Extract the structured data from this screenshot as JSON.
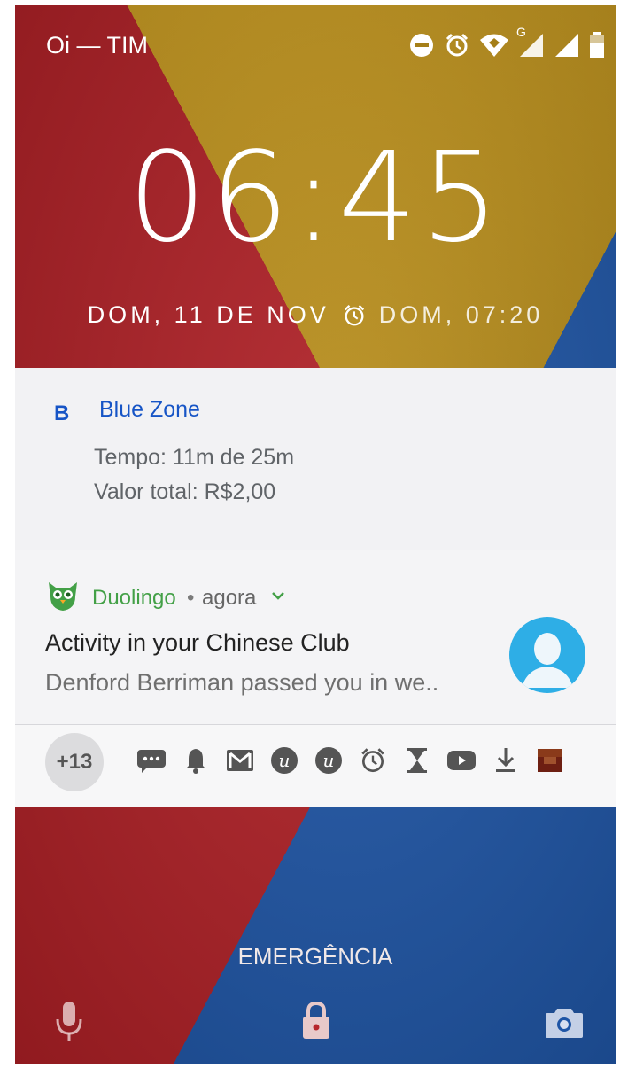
{
  "status_bar": {
    "carrier": "Oi — TIM",
    "icons": [
      "do-not-disturb-icon",
      "alarm-icon",
      "wifi-icon",
      "signal-g-icon",
      "signal-icon",
      "signal-icon",
      "battery-icon"
    ],
    "network_type": "G"
  },
  "lockscreen": {
    "time": "06:45",
    "date": "DOM, 11 DE NOV",
    "next_alarm": "DOM, 07:20"
  },
  "notifications": [
    {
      "app": "Blue Zone",
      "app_logo_letter": "B",
      "lines": [
        "Tempo: 11m de 25m",
        "Valor total: R$2,00"
      ],
      "accent_color": "#1755c6"
    },
    {
      "app": "Duolingo",
      "separator": "•",
      "time": "agora",
      "title": "Activity in your Chinese Club",
      "text": "Denford Berriman passed you in we..",
      "accent_color": "#43a047",
      "avatar_color": "#2eaee6"
    }
  ],
  "overflow": {
    "count_label": "+13",
    "icons": [
      "message-icon",
      "bell-icon",
      "gmail-icon",
      "app-u-icon",
      "app-u-icon",
      "alarm-icon",
      "hourglass-icon",
      "youtube-icon",
      "download-icon",
      "app-thumbnail-icon"
    ]
  },
  "bottom": {
    "emergency_label": "EMERGÊNCIA",
    "icons": [
      "microphone-icon",
      "lock-icon",
      "camera-icon"
    ]
  }
}
